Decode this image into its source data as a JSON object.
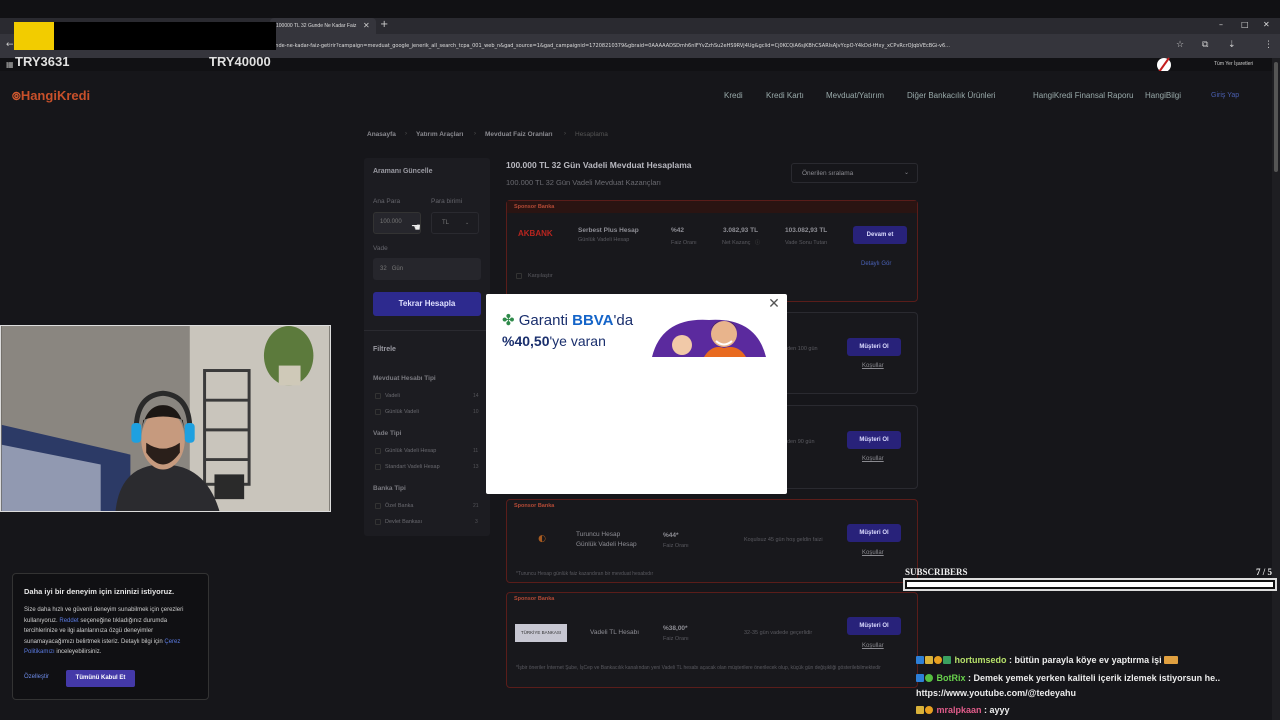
{
  "browser": {
    "active_tab_title": "100000 TL 32 Gunde Ne Kadar Faiz",
    "url": "a/100000-tl-32-gunde-ne-kadar-faiz-getirir?campaign=mevduat_google_jenerik_all_search_tcpa_001_web_n&gad_source=1&gad_campaignid=17208210379&gbraid=0AAAAADSDmh6nIFYvZzhSu2eHS9RVj4Ug&gclid=Cj0KCQiA6sjKBhCSARIsAJvYcpO-Y4kDd-tHxy_xCPvRcrOJqbVEcBGi-v6...",
    "bookmarks_label": "Tüm Yer İşaretleri"
  },
  "overlay": {
    "try1": "TRY3631",
    "try2": "TRY40000"
  },
  "site": {
    "logo_a": "Hangi",
    "logo_b": "Kredi",
    "nav": [
      "Kredi",
      "Kredi Kartı",
      "Mevduat/Yatırım",
      "Diğer Bankacılık Ürünleri",
      "HangiKredi Finansal Raporu",
      "HangiBilgi"
    ],
    "login": "Giriş Yap",
    "breadcrumb": [
      "Anasayfa",
      "Yatırım Araçları",
      "Mevduat Faiz Oranları",
      "Hesaplama"
    ]
  },
  "search_panel": {
    "title": "Aramanı Güncelle",
    "amount_label": "Ana Para",
    "amount_value": "100.000",
    "currency_label": "Para birimi",
    "currency_value": "TL",
    "term_label": "Vade",
    "term_value": "32",
    "term_unit": "Gün",
    "recalc_button": "Tekrar Hesapla"
  },
  "filters": {
    "title": "Filtrele",
    "groups": [
      {
        "title": "Mevduat Hesabı Tipi",
        "items": [
          {
            "label": "Vadeli",
            "count": "14"
          },
          {
            "label": "Günlük Vadeli",
            "count": "10"
          }
        ]
      },
      {
        "title": "Vade Tipi",
        "items": [
          {
            "label": "Günlük Vadeli Hesap",
            "count": "11"
          },
          {
            "label": "Standart Vadeli Hesap",
            "count": "13"
          }
        ]
      },
      {
        "title": "Banka Tipi",
        "items": [
          {
            "label": "Özel Banka",
            "count": "21"
          },
          {
            "label": "Devlet Bankası",
            "count": "3"
          }
        ]
      }
    ]
  },
  "results": {
    "title": "100.000 TL 32 Gün Vadeli Mevduat Hesaplama",
    "subtitle": "100.000 TL 32 Gün Vadeli Mevduat Kazançları",
    "sort_label": "Önerilen sıralama",
    "card1": {
      "sponsor": "Sponsor Banka",
      "bank_logo": "AKBANK",
      "product": "Serbest Plus Hesap",
      "product_sub": "Günlük Vadeli Hesap",
      "rate": "%42",
      "rate_label": "Faiz Oranı",
      "earnings": "3.082,93 TL",
      "earnings_label": "Net Kazanç",
      "total": "103.082,93 TL",
      "total_label": "Vade Sonu Tutarı",
      "button": "Devam et",
      "detail": "Detaylı Gör",
      "compare": "Karşılaştır"
    },
    "card2": {
      "note": "den 100 gün",
      "button": "Müşteri Ol",
      "link": "Koşullar"
    },
    "card3": {
      "note": "den 90 gün",
      "button": "Müşteri Ol",
      "link": "Koşullar"
    },
    "card4": {
      "sponsor": "Sponsor Banka",
      "product": "Turuncu Hesap",
      "product_sub": "Günlük Vadeli Hesap",
      "rate": "%44*",
      "rate_label": "Faiz Oranı",
      "note": "Koşulsuz 45 gün hoş geldin faizi",
      "button": "Müşteri Ol",
      "link": "Koşullar",
      "footnote": "*Turuncu Hesap günlük faiz kazandıran bir mevduat hesabıdır"
    },
    "card5": {
      "sponsor": "Sponsor Banka",
      "bank_logo": "TÜRKİYE BANKASI",
      "product": "Vadeli TL Hesabı",
      "rate": "%38,00*",
      "rate_label": "Faiz Oranı",
      "note": "32-35 gün vadede geçerlidir",
      "button": "Müşteri Ol",
      "link": "Koşullar",
      "footnote": "*İşbir öneriler İnternet Şube, İşCep ve Bankacılık kanalından yeni Vadeli TL hesabı açacak olan müşterilere önerilecek olup, küçük gün değişikliği gösterilebilmektedir"
    }
  },
  "popup_ad": {
    "brand": "Garanti",
    "brand_b": "BBVA",
    "brand_suffix": "'da",
    "rate_bold": "%40,50",
    "rate_rest": "'ye varan"
  },
  "stream": {
    "subscribers_label": "SUBSCRIBERS",
    "subscribers_count": "7 / 5",
    "subscribers_progress": 1.0,
    "chat": [
      {
        "user": "hortumsedo",
        "message": " : bütün parayla köye ev yaptırma işi"
      },
      {
        "user": "BotRix",
        "message": " : Demek yemek yerken kaliteli içerik izlemek istiyorsun he.."
      },
      {
        "user": "",
        "message": "https://www.youtube.com/@tedeyahu"
      },
      {
        "user": "mralpkaan",
        "message": " : ayyy"
      }
    ]
  },
  "cookie_banner": {
    "title": "Daha iyi bir deneyim için izninizi istiyoruz.",
    "body_1": "Size daha hızlı ve güvenli deneyim sunabilmek için çerezleri kullanıyoruz. ",
    "body_link1": "Reddet",
    "body_2": " seçeneğine tıkladığınız durumda tercihlerinize ve ilgi alanlarınıza özgü deneyimler sunamayacağımızı belirtmek isteriz. Detaylı bilgi için ",
    "body_link2": "Çerez Politikamızı",
    "body_3": " inceleyebilirsiniz.",
    "customize": "Özelleştir",
    "accept": "Tümünü Kabul Et"
  },
  "colors": {
    "accent": "#2d2a8e",
    "sponsor_red": "#b34a36",
    "brand": "#c8502a"
  }
}
